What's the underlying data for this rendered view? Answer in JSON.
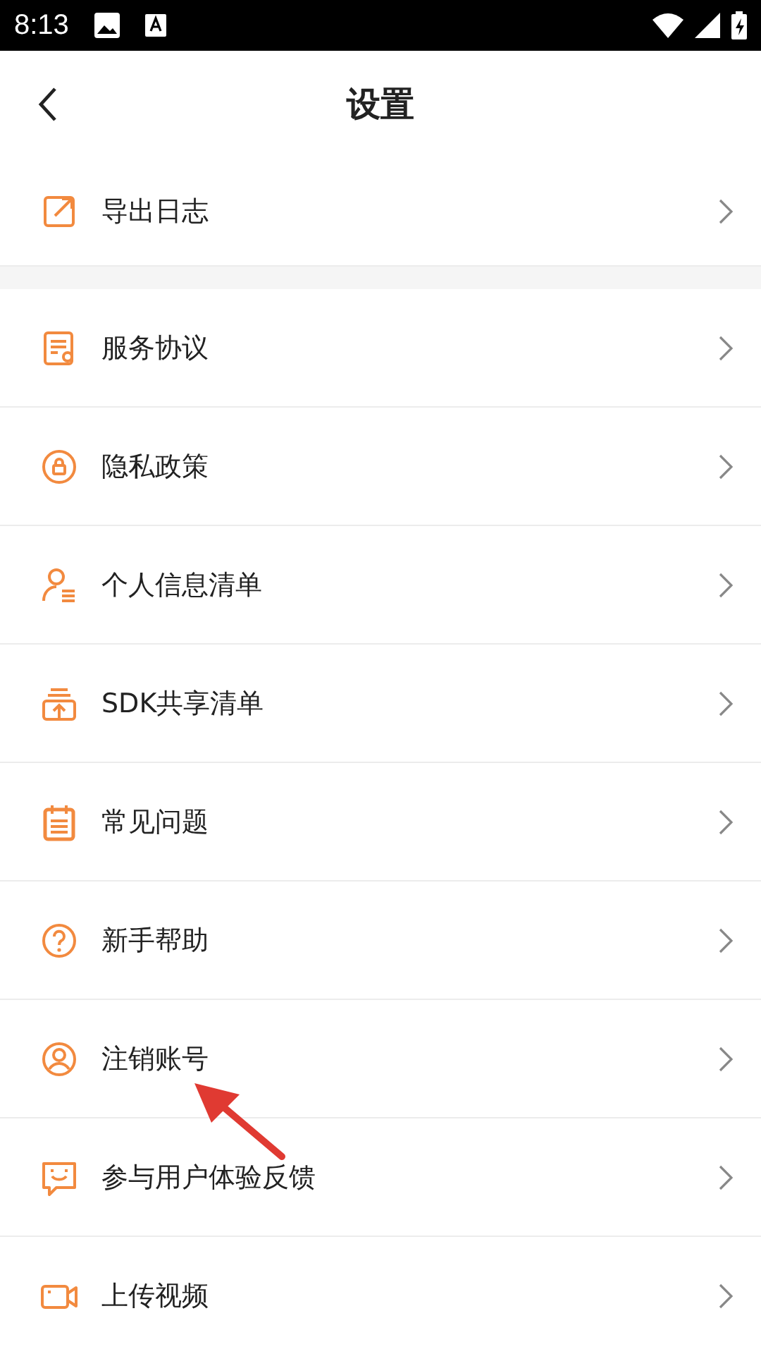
{
  "status_bar": {
    "time": "8:13"
  },
  "header": {
    "title": "设置"
  },
  "sections": [
    {
      "items": [
        {
          "label": "导出日志"
        }
      ]
    },
    {
      "items": [
        {
          "label": "服务协议"
        },
        {
          "label": "隐私政策"
        },
        {
          "label": "个人信息清单"
        },
        {
          "label": "SDK共享清单"
        },
        {
          "label": "常见问题"
        },
        {
          "label": "新手帮助"
        },
        {
          "label": "注销账号"
        },
        {
          "label": "参与用户体验反馈"
        },
        {
          "label": "上传视频"
        }
      ]
    }
  ],
  "annotation": {
    "kind": "arrow"
  }
}
